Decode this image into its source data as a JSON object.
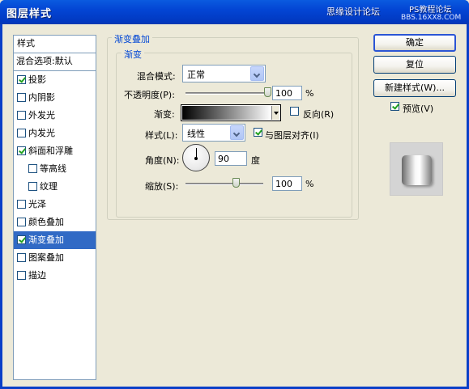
{
  "window": {
    "title": "图层样式",
    "watermark": "思缘设计论坛",
    "watermark_sub": "PS教程论坛",
    "watermark_sub2": "BBS.16XX8.COM"
  },
  "sidebar": {
    "header": "样式",
    "blend_options": "混合选项:默认",
    "items": [
      {
        "label": "投影",
        "checked": true
      },
      {
        "label": "内阴影",
        "checked": false
      },
      {
        "label": "外发光",
        "checked": false
      },
      {
        "label": "内发光",
        "checked": false
      },
      {
        "label": "斜面和浮雕",
        "checked": true
      },
      {
        "label": "等高线",
        "checked": false
      },
      {
        "label": "纹理",
        "checked": false
      },
      {
        "label": "光泽",
        "checked": false
      },
      {
        "label": "颜色叠加",
        "checked": false
      },
      {
        "label": "渐变叠加",
        "checked": true
      },
      {
        "label": "图案叠加",
        "checked": false
      },
      {
        "label": "描边",
        "checked": false
      }
    ]
  },
  "panel": {
    "title": "渐变叠加",
    "section": "渐变",
    "blend_mode_label": "混合模式:",
    "blend_mode_value": "正常",
    "opacity_label": "不透明度(P):",
    "opacity_value": "100",
    "opacity_unit": "%",
    "opacity_level": 1.0,
    "gradient_label": "渐变:",
    "reverse_label": "反向(R)",
    "reverse_checked": false,
    "style_label": "样式(L):",
    "style_value": "线性",
    "align_label": "与图层对齐(I)",
    "align_checked": true,
    "angle_label": "角度(N):",
    "angle_value": "90",
    "angle_unit": "度",
    "scale_label": "缩放(S):",
    "scale_value": "100",
    "scale_unit": "%",
    "scale_level": 0.6
  },
  "buttons": {
    "ok": "确定",
    "reset": "复位",
    "new_style": "新建样式(W)...",
    "preview_label": "预览(V)",
    "preview_checked": true
  },
  "colors": {
    "titlebar": "#0345d4",
    "selection": "#316ac5",
    "legend_text": "#0046d5"
  }
}
